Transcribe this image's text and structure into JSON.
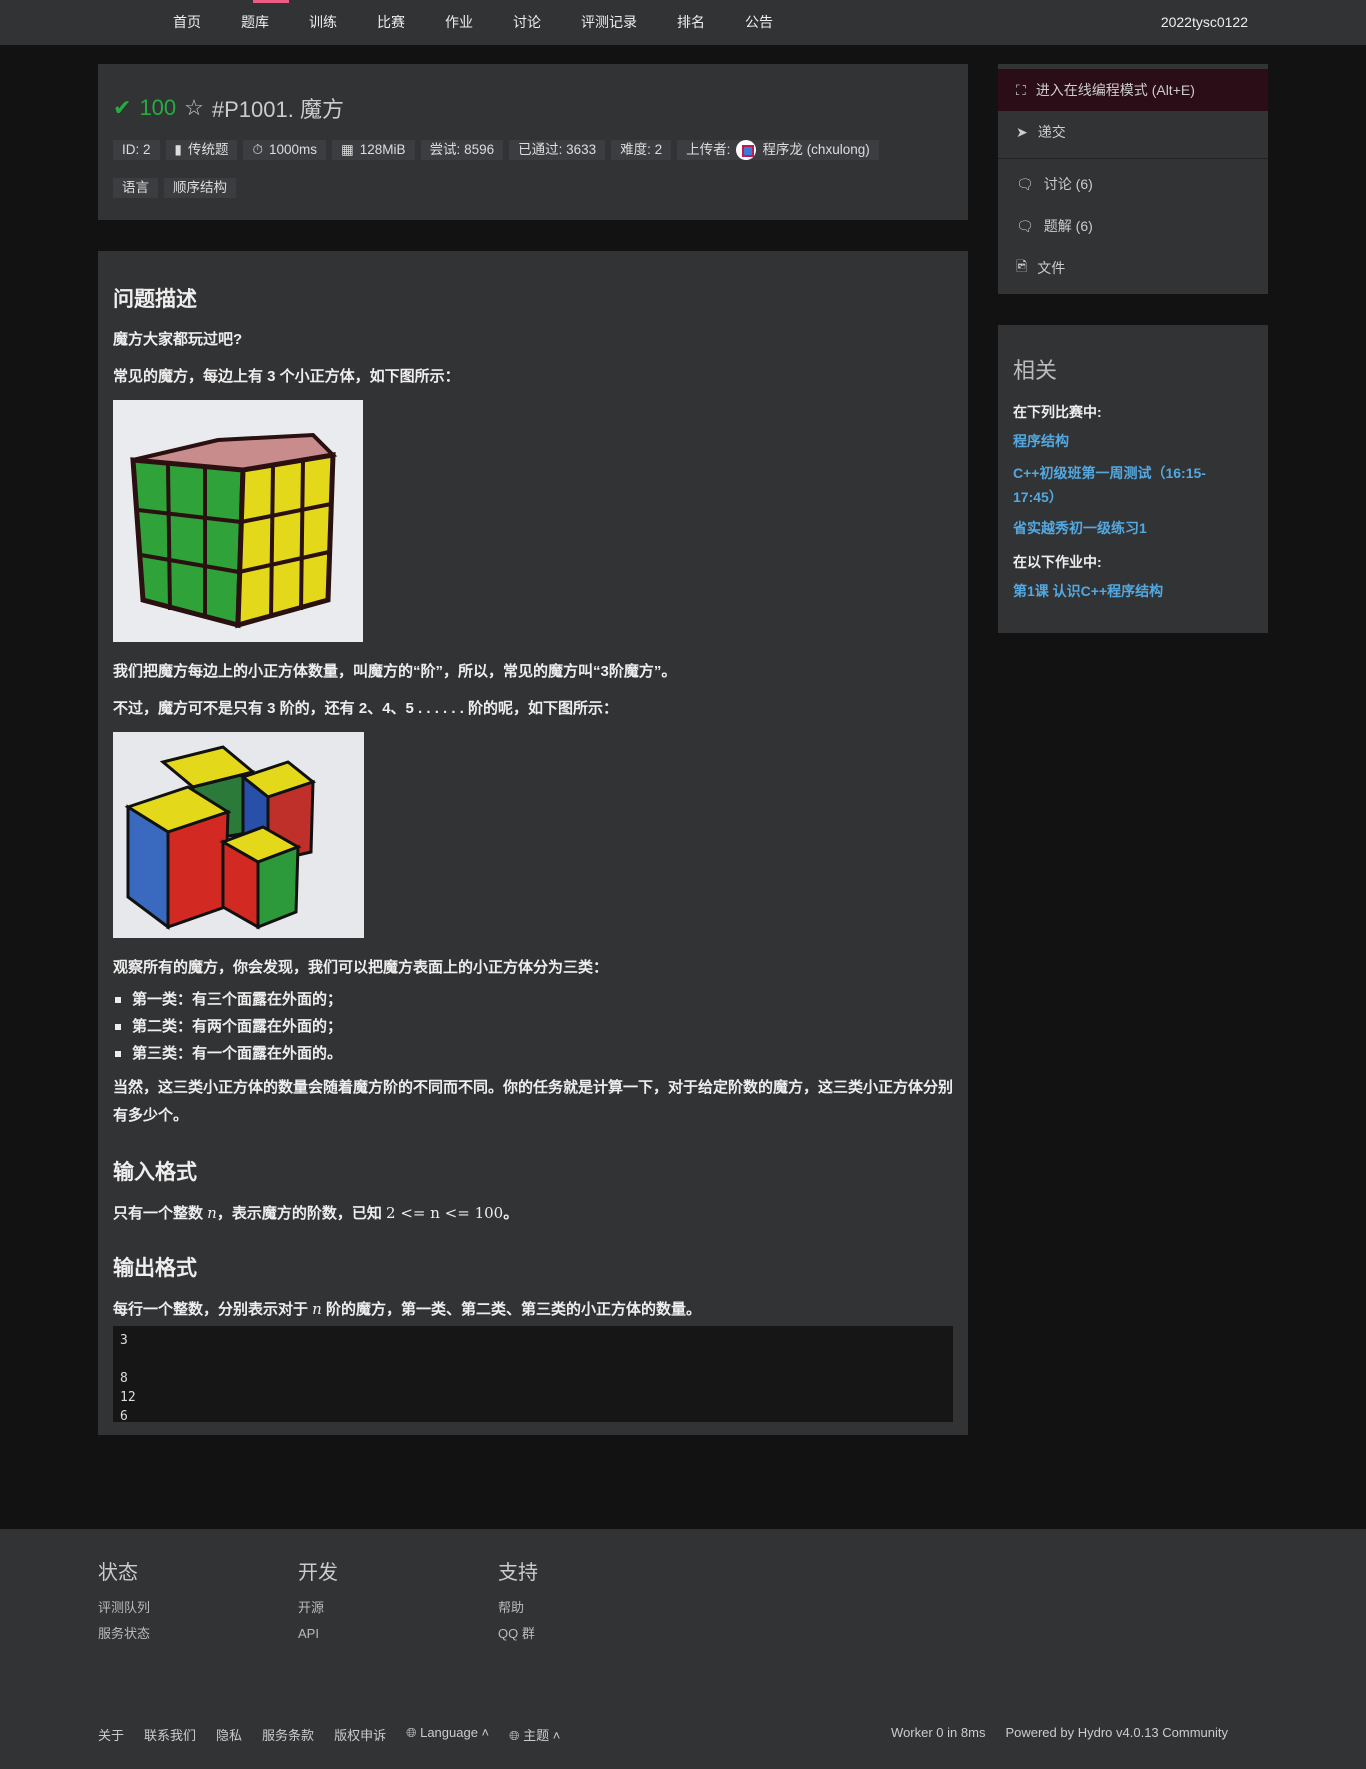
{
  "nav": {
    "items": [
      "首页",
      "题库",
      "训练",
      "比赛",
      "作业",
      "讨论",
      "评测记录",
      "排名",
      "公告"
    ],
    "active": "题库",
    "user": "2022tysc0122"
  },
  "problem": {
    "score": "100",
    "title": "#P1001. 魔方",
    "badges": {
      "id": "ID: 2",
      "type": "传统题",
      "time": "1000ms",
      "memory": "128MiB",
      "tried": "尝试: 8596",
      "accepted": "已通过: 3633",
      "difficulty": "难度: 2",
      "uploader_label": "上传者:",
      "uploader": "程序龙 (chxulong)"
    },
    "tags": [
      "语言",
      "顺序结构"
    ]
  },
  "content": {
    "h_desc": "问题描述",
    "p1": "魔方大家都玩过吧?",
    "p2": "常见的魔方，每边上有 3 个小正方体，如下图所示：",
    "p3": "我们把魔方每边上的小正方体数量，叫魔方的“阶”，所以，常见的魔方叫“3阶魔方”。",
    "p4": "不过，魔方可不是只有 3 阶的，还有 2、4、5 . . . . . . 阶的呢，如下图所示：",
    "p5": "观察所有的魔方，你会发现，我们可以把魔方表面上的小正方体分为三类：",
    "list": [
      "第一类：有三个面露在外面的；",
      "第二类：有两个面露在外面的；",
      "第三类：有一个面露在外面的。"
    ],
    "p6": "当然，这三类小正方体的数量会随着魔方阶的不同而不同。你的任务就是计算一下，对于给定阶数的魔方，这三类小正方体分别有多少个。",
    "h_input": "输入格式",
    "input_a": "只有一个整数 ",
    "input_var": "n",
    "input_b": "，表示魔方的阶数，已知 ",
    "input_math": "2 <= n <= 100",
    "input_c": "。",
    "h_output": "输出格式",
    "output_a": "每行一个整数，分别表示对于 ",
    "output_var": "n",
    "output_b": " 阶的魔方，第一类、第二类、第三类的小正方体的数量。",
    "sample": "3\n\n8\n12\n6"
  },
  "sidebar": {
    "ide": "进入在线编程模式 (Alt+E)",
    "submit": "递交",
    "discuss": "讨论 (6)",
    "solution": "题解 (6)",
    "files": "文件"
  },
  "related": {
    "title": "相关",
    "contests_label": "在下列比赛中:",
    "contests": [
      "程序结构",
      "C++初级班第一周测试（16:15-17:45）",
      "省实越秀初一级练习1"
    ],
    "homework_label": "在以下作业中:",
    "homework": [
      "第1课 认识C++程序结构"
    ]
  },
  "footer": {
    "cols": [
      {
        "title": "状态",
        "links": [
          "评测队列",
          "服务状态"
        ]
      },
      {
        "title": "开发",
        "links": [
          "开源",
          "API"
        ]
      },
      {
        "title": "支持",
        "links": [
          "帮助",
          "QQ 群"
        ]
      }
    ],
    "bottom": [
      "关于",
      "联系我们",
      "隐私",
      "服务条款",
      "版权申诉"
    ],
    "language": "Language",
    "theme": "主题",
    "worker": "Worker 0 in 8ms",
    "powered": "Powered by Hydro v4.0.13 Community"
  },
  "colors": {
    "accent": "#ec5d85",
    "success": "#25ad40",
    "link": "#53a8e0"
  }
}
